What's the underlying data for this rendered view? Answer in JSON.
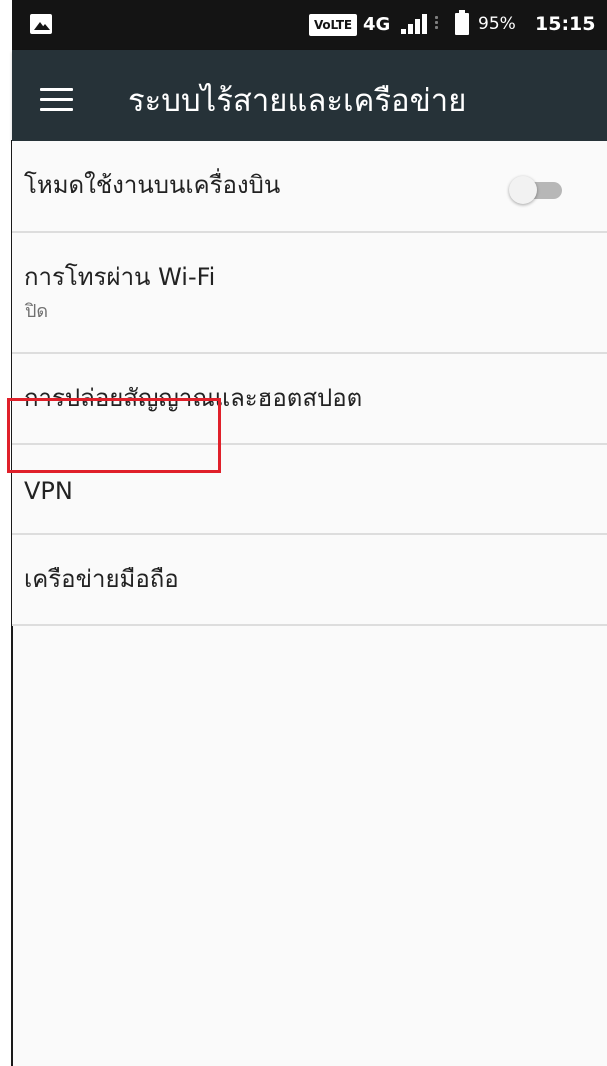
{
  "status_bar": {
    "left_icon": "image-icon",
    "volte": "VoLTE",
    "network_type": "4G",
    "signal_icon": "signal-bars-icon",
    "battery_icon": "battery-icon",
    "battery_percent": "95%",
    "time": "15:15"
  },
  "app_bar": {
    "menu_icon": "hamburger-menu-icon",
    "title": "ระบบไร้สายและเครือข่าย"
  },
  "settings": {
    "airplane_mode": {
      "label": "โหมดใช้งานบนเครื่องบิน",
      "toggle_state": "off"
    },
    "wifi_calling": {
      "label": "การโทรผ่าน Wi-Fi",
      "summary": "ปิด"
    },
    "tethering_hotspot": {
      "label": "การปล่อยสัญญาณและฮอตสปอต"
    },
    "vpn": {
      "label": "VPN"
    },
    "mobile_network": {
      "label": "เครือข่ายมือถือ",
      "highlight_color": "#e0202a"
    }
  },
  "colors": {
    "status_bar": "#141414",
    "app_bar": "#263238",
    "background": "#fafafa",
    "divider": "#dddddd",
    "primary_text": "#222222",
    "secondary_text": "#707070",
    "highlight": "#e0202a"
  }
}
